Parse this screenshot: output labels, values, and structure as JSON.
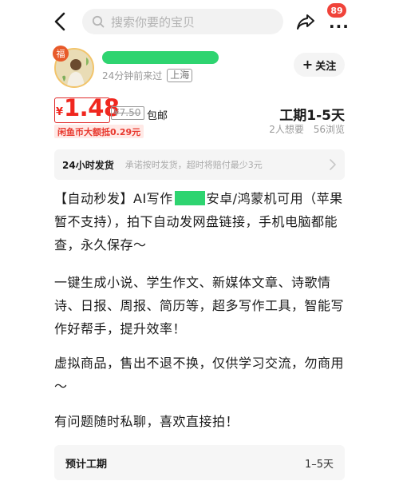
{
  "search": {
    "placeholder": "搜索你要的宝贝"
  },
  "notifications": {
    "count": "89"
  },
  "seller": {
    "avatar_tag": "福",
    "last_seen": "24分钟前来过",
    "location": "上海",
    "follow_label": "关注"
  },
  "price": {
    "currency": "¥",
    "current": "1.48",
    "original": "¥7.50",
    "shipping": "包邮",
    "coin_discount": "闲鱼币大额抵0.29元"
  },
  "delivery": {
    "eta": "工期1-5天"
  },
  "stats": {
    "wants": "2人想要",
    "views": "56浏览"
  },
  "shipping_promise": {
    "title": "24小时发货",
    "desc": "承诺按时发货，超时将赔付最少3元"
  },
  "description": {
    "p1_before": "【自动秒发】AI写作",
    "p1_after": "安卓/鸿蒙机可用（苹果暂不支持），拍下自动发网盘链接，手机电脑都能查，永久保存～",
    "p2": "一键生成小说、学生作文、新媒体文章、诗歌情诗、日报、周报、简历等，超多写作工具，智能写作好帮手，提升效率！",
    "p3": "虚拟商品，售出不退不换，仅供学习交流，勿商用～",
    "p4": "有问题随时私聊，喜欢直接拍！"
  },
  "estimate": {
    "label": "预计工期",
    "value": "1–5天"
  },
  "colors": {
    "accent_red": "#f0271f",
    "redaction_green": "#2ed470"
  },
  "icons": [
    "back-icon",
    "search-icon",
    "share-icon",
    "more-icon",
    "chevron-right-icon"
  ]
}
